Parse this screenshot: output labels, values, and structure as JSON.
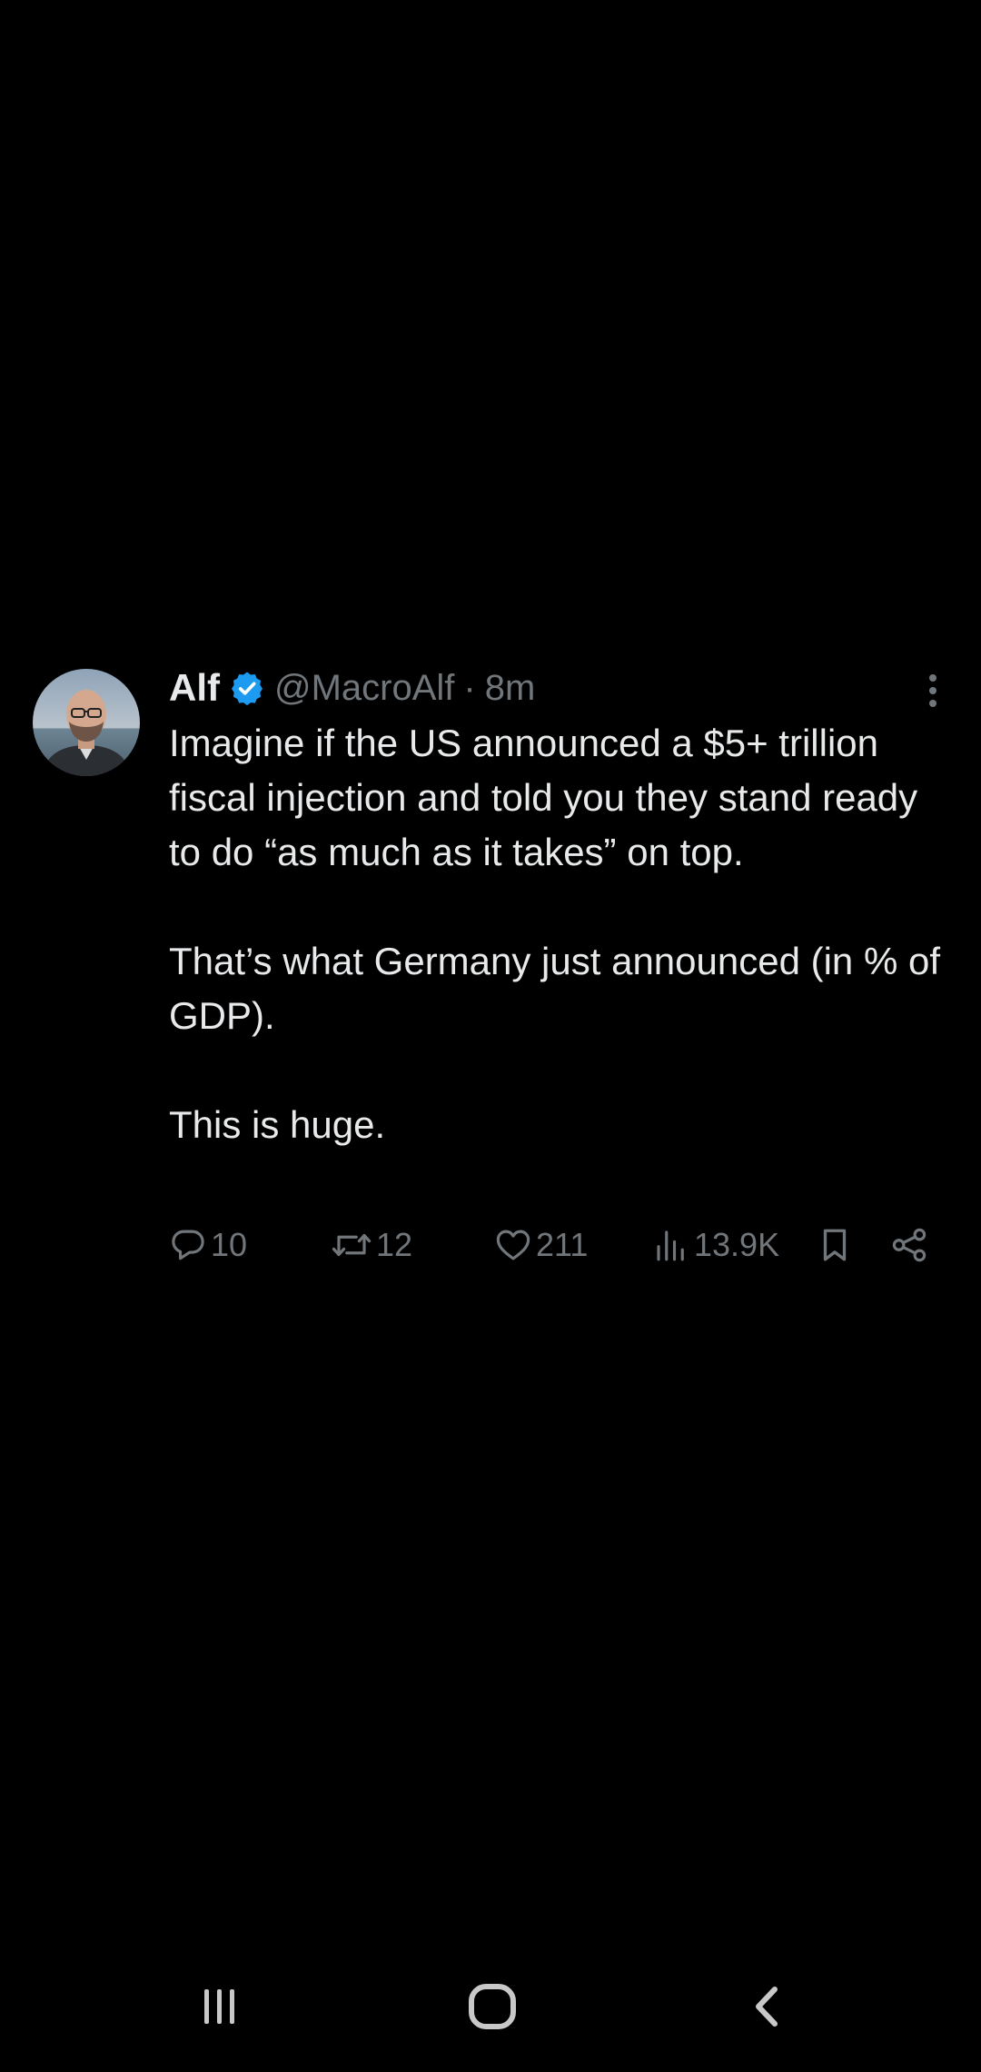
{
  "tweet": {
    "author": {
      "display_name": "Alf",
      "handle": "@MacroAlf",
      "verified": true,
      "avatar_icon": "profile-photo"
    },
    "separator": "·",
    "time": "8m",
    "paragraphs": [
      "Imagine if the US announced a $5+ trillion fiscal injection and told you they stand ready to do “as much as it takes” on top.",
      "That’s what Germany just announced (in % of GDP).",
      "This is huge."
    ],
    "actions": {
      "replies": "10",
      "reposts": "12",
      "likes": "211",
      "views": "13.9K"
    }
  },
  "colors": {
    "background": "#000000",
    "text_primary": "#e7e9ea",
    "text_secondary": "#71767b",
    "verified_blue": "#1d9bf0"
  },
  "icons": {
    "reply": "comment-bubble-icon",
    "repost": "repost-arrows-icon",
    "like": "heart-icon",
    "views": "bar-chart-icon",
    "bookmark": "bookmark-icon",
    "share": "share-icon",
    "more": "vertical-dots-icon",
    "nav_recents": "recent-apps-icon",
    "nav_home": "home-icon",
    "nav_back": "back-icon"
  }
}
